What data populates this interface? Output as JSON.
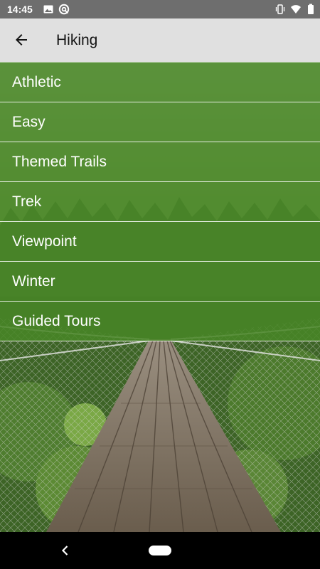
{
  "status_bar": {
    "time": "14:45",
    "icons": [
      "image-icon",
      "sync-icon",
      "vibrate-icon",
      "wifi-icon",
      "battery-icon"
    ]
  },
  "app_bar": {
    "title": "Hiking",
    "back_icon": "arrow-back-icon"
  },
  "categories": [
    {
      "label": "Athletic"
    },
    {
      "label": "Easy"
    },
    {
      "label": "Themed Trails"
    },
    {
      "label": "Trek"
    },
    {
      "label": "Viewpoint"
    },
    {
      "label": "Winter"
    },
    {
      "label": "Guided Tours"
    }
  ],
  "background": {
    "subject": "suspension bridge in forest"
  },
  "nav_bar": {
    "icons": [
      "nav-back-icon",
      "nav-home-pill"
    ]
  },
  "colors": {
    "status_bar": "#6e6e6e",
    "app_bar": "#e0e0e0",
    "overlay_green": "#4f8a2c",
    "nav_bar": "#000000",
    "text_light": "#ffffff",
    "text_dark": "#141414"
  }
}
